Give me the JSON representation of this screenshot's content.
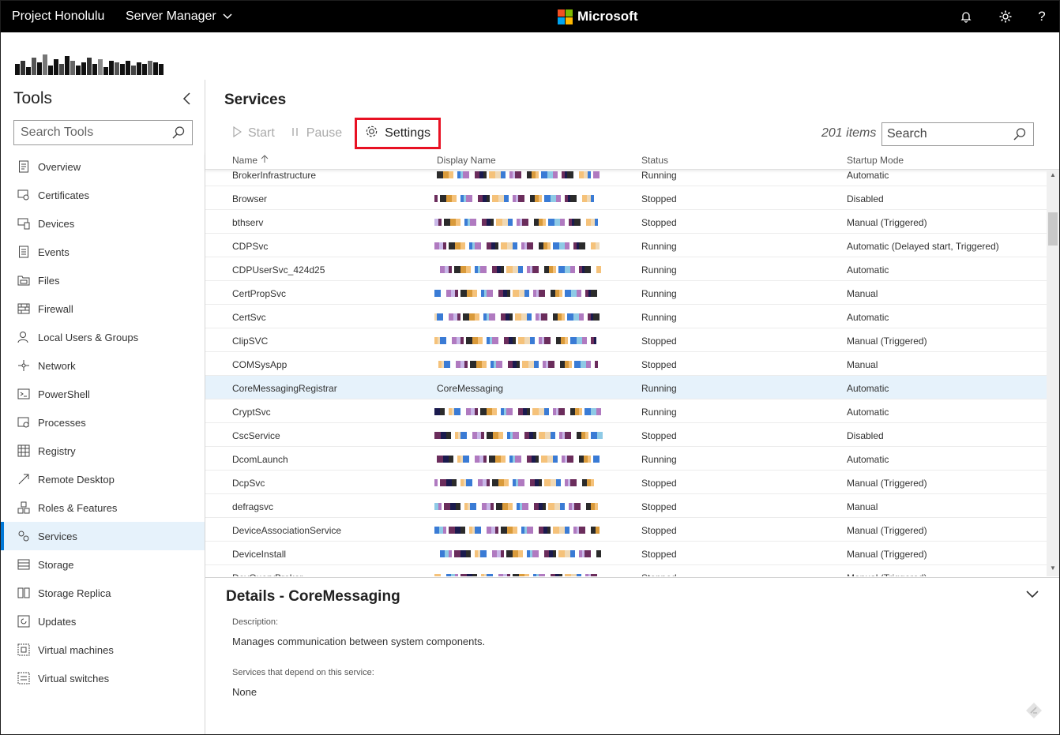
{
  "topbar": {
    "app_title": "Project Honolulu",
    "server_manager": "Server Manager",
    "brand": "Microsoft",
    "icons": [
      "bell-icon",
      "gear-icon",
      "help-icon"
    ],
    "help_glyph": "?"
  },
  "sidebar": {
    "title": "Tools",
    "search_placeholder": "Search Tools",
    "items": [
      {
        "label": "Overview",
        "icon": "overview-icon"
      },
      {
        "label": "Certificates",
        "icon": "certificate-icon"
      },
      {
        "label": "Devices",
        "icon": "devices-icon"
      },
      {
        "label": "Events",
        "icon": "events-icon"
      },
      {
        "label": "Files",
        "icon": "files-icon"
      },
      {
        "label": "Firewall",
        "icon": "firewall-icon"
      },
      {
        "label": "Local Users & Groups",
        "icon": "users-icon"
      },
      {
        "label": "Network",
        "icon": "network-icon"
      },
      {
        "label": "PowerShell",
        "icon": "powershell-icon"
      },
      {
        "label": "Processes",
        "icon": "processes-icon"
      },
      {
        "label": "Registry",
        "icon": "registry-icon"
      },
      {
        "label": "Remote Desktop",
        "icon": "remote-desktop-icon"
      },
      {
        "label": "Roles & Features",
        "icon": "roles-icon"
      },
      {
        "label": "Services",
        "icon": "services-icon",
        "active": true
      },
      {
        "label": "Storage",
        "icon": "storage-icon"
      },
      {
        "label": "Storage Replica",
        "icon": "storage-replica-icon"
      },
      {
        "label": "Updates",
        "icon": "updates-icon"
      },
      {
        "label": "Virtual machines",
        "icon": "vm-icon"
      },
      {
        "label": "Virtual switches",
        "icon": "vswitch-icon"
      }
    ]
  },
  "main": {
    "title": "Services",
    "toolbar": {
      "start": "Start",
      "pause": "Pause",
      "settings": "Settings"
    },
    "items_count": "201 items",
    "search_placeholder": "Search",
    "columns": {
      "name": "Name",
      "display": "Display Name",
      "status": "Status",
      "startup": "Startup Mode"
    },
    "rows": [
      {
        "name": "BrokerInfrastructure",
        "display": "",
        "status": "Running",
        "startup": "Automatic"
      },
      {
        "name": "Browser",
        "display": "",
        "status": "Stopped",
        "startup": "Disabled"
      },
      {
        "name": "bthserv",
        "display": "",
        "status": "Stopped",
        "startup": "Manual (Triggered)"
      },
      {
        "name": "CDPSvc",
        "display": "",
        "status": "Running",
        "startup": "Automatic (Delayed start, Triggered)"
      },
      {
        "name": "CDPUserSvc_424d25",
        "display": "",
        "status": "Running",
        "startup": "Automatic"
      },
      {
        "name": "CertPropSvc",
        "display": "",
        "status": "Running",
        "startup": "Manual"
      },
      {
        "name": "CertSvc",
        "display": "",
        "status": "Running",
        "startup": "Automatic"
      },
      {
        "name": "ClipSVC",
        "display": "",
        "status": "Stopped",
        "startup": "Manual (Triggered)"
      },
      {
        "name": "COMSysApp",
        "display": "",
        "status": "Stopped",
        "startup": "Manual"
      },
      {
        "name": "CoreMessagingRegistrar",
        "display": "CoreMessaging",
        "status": "Running",
        "startup": "Automatic",
        "selected": true
      },
      {
        "name": "CryptSvc",
        "display": "",
        "status": "Running",
        "startup": "Automatic"
      },
      {
        "name": "CscService",
        "display": "",
        "status": "Stopped",
        "startup": "Disabled"
      },
      {
        "name": "DcomLaunch",
        "display": "",
        "status": "Running",
        "startup": "Automatic"
      },
      {
        "name": "DcpSvc",
        "display": "",
        "status": "Stopped",
        "startup": "Manual (Triggered)"
      },
      {
        "name": "defragsvc",
        "display": "",
        "status": "Stopped",
        "startup": "Manual"
      },
      {
        "name": "DeviceAssociationService",
        "display": "",
        "status": "Stopped",
        "startup": "Manual (Triggered)"
      },
      {
        "name": "DeviceInstall",
        "display": "",
        "status": "Stopped",
        "startup": "Manual (Triggered)"
      },
      {
        "name": "DevQueryBroker",
        "display": "",
        "status": "Stopped",
        "startup": "Manual (Triggered)"
      }
    ]
  },
  "details": {
    "title": "Details - CoreMessaging",
    "description_label": "Description:",
    "description": "Manages communication between system components.",
    "dependents_label": "Services that depend on this service:",
    "dependents": "None"
  },
  "colors": {
    "accent": "#0078d7",
    "selected_row": "#e6f2fb",
    "highlight_box": "#e81123",
    "topbar": "#000000"
  }
}
